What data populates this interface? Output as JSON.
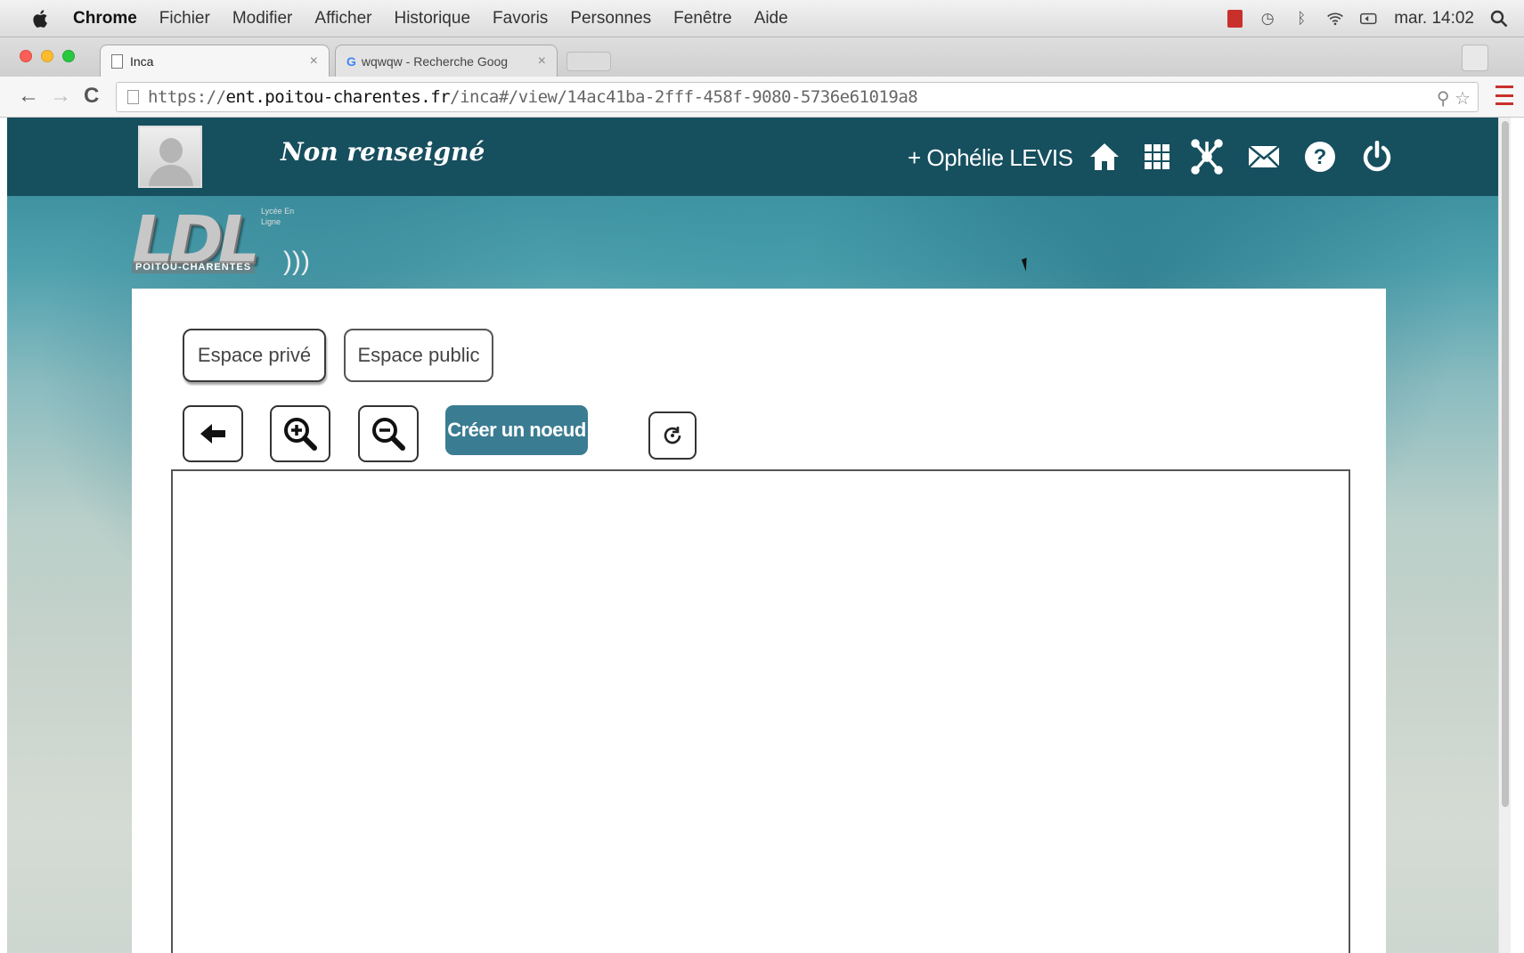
{
  "menubar": {
    "app": "Chrome",
    "items": [
      "Fichier",
      "Modifier",
      "Afficher",
      "Historique",
      "Favoris",
      "Personnes",
      "Fenêtre",
      "Aide"
    ],
    "clock": "mar. 14:02",
    "status_icons": [
      "battery-alert-icon",
      "time-machine-icon",
      "bluetooth-icon",
      "wifi-icon",
      "volume-icon",
      "spotlight-icon"
    ]
  },
  "tabs": [
    {
      "title": "Inca",
      "active": true
    },
    {
      "title": "wqwqw - Recherche Goog",
      "active": false
    }
  ],
  "address": {
    "scheme": "https://",
    "host": "ent.poitou-charentes.fr",
    "path": "/inca#/view/14ac41ba-2fff-458f-9080-5736e61019a8"
  },
  "header": {
    "school_name": "Non renseigné",
    "user_name": "+ Ophélie LEVIS",
    "icons": [
      "home-icon",
      "apps-grid-icon",
      "community-icon",
      "mail-icon",
      "help-icon",
      "power-icon"
    ],
    "bg_color": "#164f5e"
  },
  "logo": {
    "text": "LDL",
    "subtitle": "POITOU-CHARENTES",
    "tagline": "Lycée En Ligne"
  },
  "spaces": {
    "private": "Espace privé",
    "public": "Espace public"
  },
  "toolbar": {
    "create_label": "Créer un noeud",
    "accent": "#3a7c92"
  }
}
